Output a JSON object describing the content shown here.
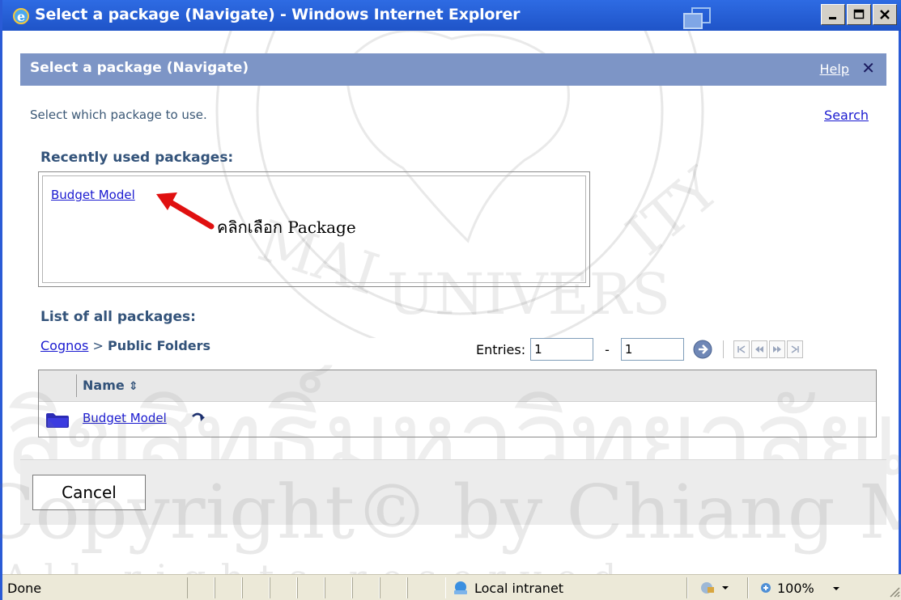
{
  "window": {
    "title": "Select a package (Navigate) - Windows Internet Explorer",
    "caption_buttons": [
      "minimize",
      "maximize",
      "close"
    ]
  },
  "dialog": {
    "title": "Select a package (Navigate)",
    "help_label": "Help",
    "close_label": "✕",
    "instruction": "Select which package to use.",
    "search_label": "Search",
    "recent_heading": "Recently used packages:",
    "recent_packages": [
      "Budget Model"
    ],
    "annotation": "คลิกเลือก Package",
    "all_heading": "List of all packages:",
    "breadcrumb": {
      "root": "Cognos",
      "separator": ">",
      "current": "Public Folders"
    },
    "entries": {
      "label": "Entries:",
      "from": "1",
      "separator": "-",
      "to": "1"
    },
    "table": {
      "column_name": "Name",
      "rows": [
        {
          "name": "Budget Model",
          "icon": "folder-icon"
        }
      ]
    },
    "cancel_label": "Cancel"
  },
  "statusbar": {
    "status": "Done",
    "zone": "Local intranet",
    "zoom": "100%"
  },
  "watermark": {
    "thai": "ลิขสิทธิ์มหาวิทยาลัยเชียงใหม่",
    "copyright": "Copyright© by Chiang Mai University",
    "rights": "All rights reserved"
  },
  "colors": {
    "titlebar": "#2e6be3",
    "dialog_header": "#7d95c6",
    "heading_text": "#33537a",
    "link": "#1a1ad0",
    "annotation_arrow": "#e01010"
  }
}
